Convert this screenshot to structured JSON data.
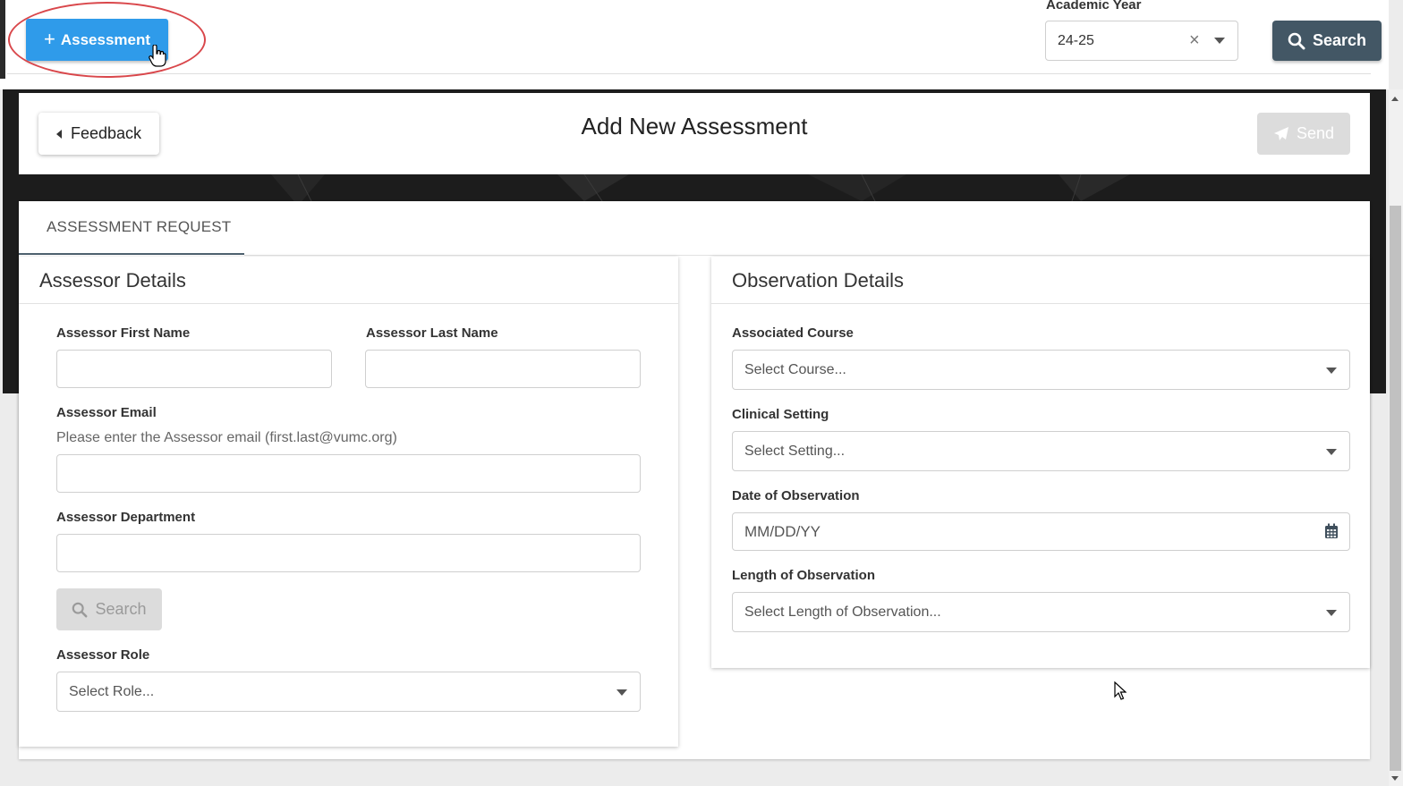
{
  "toolbar": {
    "assessment_button_label": "Assessment",
    "academic_year_label": "Academic Year",
    "academic_year_value": "24-25",
    "clear_glyph": "×",
    "search_button_label": "Search"
  },
  "header": {
    "feedback_label": "Feedback",
    "title": "Add New Assessment",
    "send_label": "Send"
  },
  "tabs": [
    {
      "label": "ASSESSMENT REQUEST",
      "active": true
    }
  ],
  "assessor": {
    "title": "Assessor Details",
    "first_name_label": "Assessor First Name",
    "first_name_value": "",
    "last_name_label": "Assessor Last Name",
    "last_name_value": "",
    "email_label": "Assessor Email",
    "email_hint": "Please enter the Assessor email (first.last@vumc.org)",
    "email_value": "",
    "department_label": "Assessor Department",
    "department_value": "",
    "search_label": "Search",
    "role_label": "Assessor Role",
    "role_placeholder": "Select Role..."
  },
  "observation": {
    "title": "Observation Details",
    "course_label": "Associated Course",
    "course_placeholder": "Select Course...",
    "setting_label": "Clinical Setting",
    "setting_placeholder": "Select Setting...",
    "date_label": "Date of Observation",
    "date_placeholder": "MM/DD/YY",
    "length_label": "Length of Observation",
    "length_placeholder": "Select Length of Observation..."
  },
  "colors": {
    "primary_blue": "#2f9bea",
    "dark_slate": "#435765",
    "highlight_red": "#d9474b",
    "disabled_gray": "#dcdcdc"
  }
}
